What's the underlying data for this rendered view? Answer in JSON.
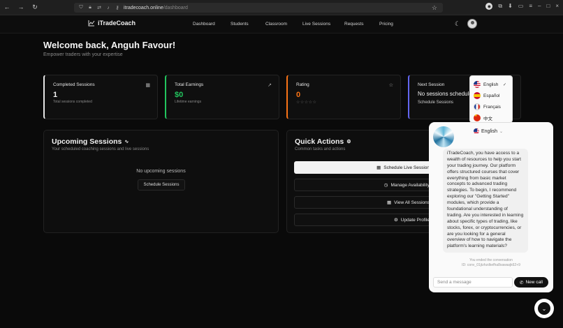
{
  "browser": {
    "url_host": "itradecoach.online",
    "url_path": "/dashboard"
  },
  "nav": {
    "brand": "iTradeCoach",
    "items": [
      "Dashboard",
      "Students",
      "Classroom",
      "Live Sessions",
      "Requests",
      "Pricing"
    ]
  },
  "header": {
    "title": "Welcome back, Anguh Favour!",
    "subtitle": "Empower traders with your expertise"
  },
  "stats": [
    {
      "title": "Completed Sessions",
      "value": "1",
      "sub": "Total sessions completed",
      "accent": "#e5e5e5",
      "icon": "calendar-icon"
    },
    {
      "title": "Total Earnings",
      "value": "$0",
      "sub": "Lifetime earnings",
      "accent": "#22c55e",
      "icon": "trend-icon"
    },
    {
      "title": "Rating",
      "value": "0",
      "stars": "☆☆☆☆☆",
      "accent": "#f97316",
      "icon": "star-icon"
    },
    {
      "title": "Next Session",
      "value": "No sessions schedule",
      "sub": "Schedule Sessions",
      "accent": "#6366f1",
      "icon": "clock-icon"
    }
  ],
  "upcoming": {
    "title": "Upcoming Sessions",
    "subtitle": "Your scheduled coaching sessions and live sessions",
    "empty_text": "No upcoming sessions",
    "button": "Schedule Sessions"
  },
  "quick_actions": {
    "title": "Quick Actions",
    "subtitle": "Common tasks and actions",
    "buttons": [
      "Schedule Live Session",
      "Manage Availability",
      "View All Sessions",
      "Update Profile"
    ]
  },
  "language_menu": {
    "options": [
      "English",
      "Español",
      "Français",
      "中文"
    ],
    "selected": "English"
  },
  "chat": {
    "language": "English",
    "message": "iTradeCoach, you have access to a wealth of resources to help you start your trading journey. Our platform offers structured courses that cover everything from basic market concepts to advanced trading strategies. To begin, I recommend exploring our \"Getting Started\" modules, which provide a foundational understanding of trading. Are you interested in learning about specific types of trading, like stocks, forex, or cryptocurrencies, or are you looking for a general overview of how to navigate the platform's learning materials?",
    "ended_line1": "You ended the conversation",
    "ended_line2": "ID: conv_01jtzhzdkefha8xawasjk62+9",
    "input_placeholder": "Send a message",
    "call_button": "New call"
  }
}
